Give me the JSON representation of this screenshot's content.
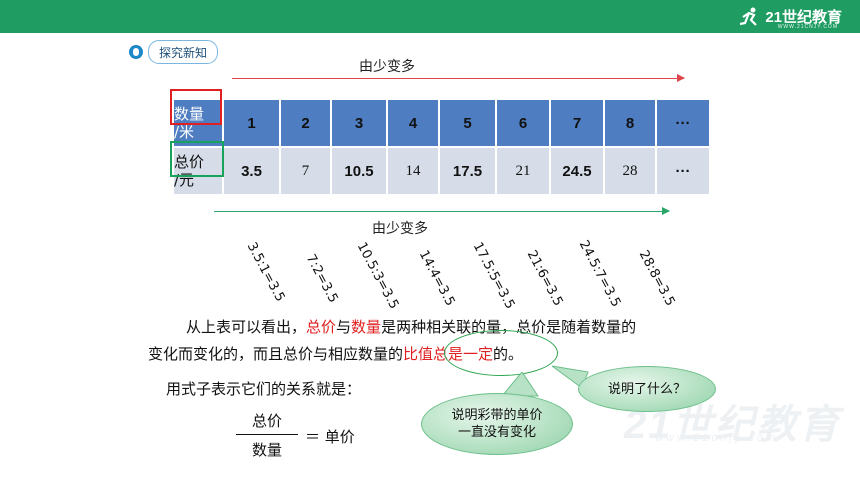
{
  "header": {
    "logo_text": "21世纪教育",
    "logo_subtext": "WWW.21CNJY.COM",
    "bar_color": "#1f9c62"
  },
  "section_tag": {
    "label": "探究新知",
    "icon": "bulb-icon"
  },
  "top_arrow": {
    "label": "由少变多",
    "color": "#e0444b"
  },
  "bottom_arrow": {
    "label": "由少变多",
    "color": "#28a66a"
  },
  "table": {
    "row1_header_line1": "数量",
    "row1_header_line2": "/米",
    "row2_header_line1": "总价",
    "row2_header_line2": "/元",
    "quantities": [
      "1",
      "2",
      "3",
      "4",
      "5",
      "6",
      "7",
      "8",
      "···"
    ],
    "prices": [
      "3.5",
      "7",
      "10.5",
      "14",
      "17.5",
      "21",
      "24.5",
      "28",
      "···"
    ]
  },
  "ratios": [
    "3.5:1=3.5",
    "7:2=3.5",
    "10.5:3=3.5",
    "14:4=3.5",
    "17.5:5=3.5",
    "21:6=3.5",
    "24.5:7=3.5",
    "28:8=3.5"
  ],
  "paragraph": {
    "p1": "从上表可以看出，",
    "p2": "总价",
    "p3": "与",
    "p4": "数量",
    "p5": "是两种相关联的量，总价是随着数量的",
    "p6": "变化而变化的，而且总价与相应数量的",
    "p7": "比值总是一定",
    "p8": "的。"
  },
  "expression": {
    "intro": "用式子表示它们的关系就是：",
    "numerator": "总价",
    "denominator": "数量",
    "rhs": "＝ 单价"
  },
  "callouts": {
    "bubble1": "说明彩带的单价一直没有变化",
    "bubble1_line1": "说明彩带的单价",
    "bubble1_line2": "一直没有变化",
    "bubble2": "说明了什么？"
  },
  "watermark": {
    "main": "21世纪教育",
    "sub": "www.21cnjy.com"
  }
}
